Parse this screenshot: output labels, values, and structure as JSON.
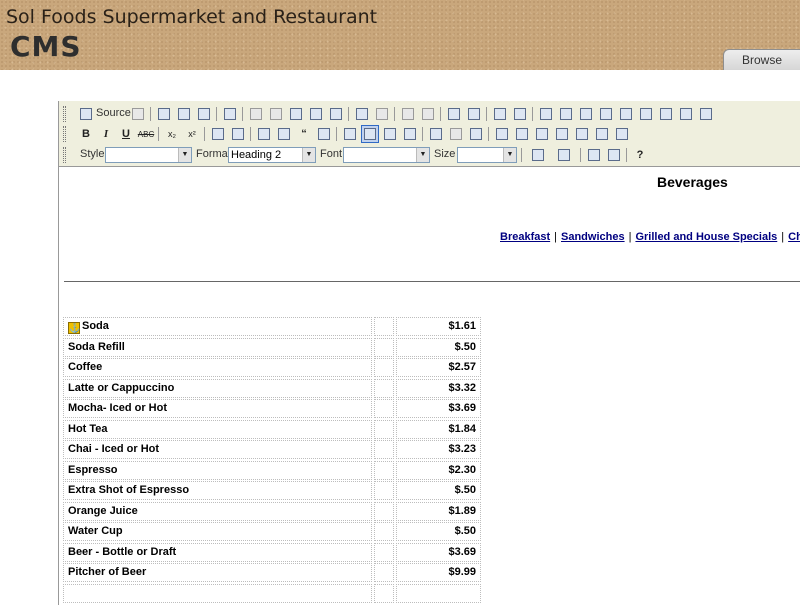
{
  "header": {
    "site_title": "Sol Foods Supermarket and Restaurant",
    "logo_text": "CMS",
    "browse_tab": "Browse"
  },
  "toolbar": {
    "source_label": "Source",
    "style_label": "Style",
    "style_value": "",
    "format_label": "Format",
    "format_value": "Heading 2",
    "font_label": "Font",
    "font_value": "",
    "size_label": "Size",
    "size_value": ""
  },
  "content": {
    "heading": "Beverages",
    "nav_links": [
      "Breakfast",
      "Sandwiches",
      "Grilled and House Specials",
      "Child"
    ],
    "pipe": "|",
    "menu_items": [
      {
        "name": "Soda",
        "price": "$1.61"
      },
      {
        "name": "Soda Refill",
        "price": "$.50"
      },
      {
        "name": "Coffee",
        "price": "$2.57"
      },
      {
        "name": "Latte or Cappuccino",
        "price": "$3.32"
      },
      {
        "name": "Mocha- Iced or Hot",
        "price": "$3.69"
      },
      {
        "name": "Hot Tea",
        "price": "$1.84"
      },
      {
        "name": "Chai - Iced or Hot",
        "price": "$3.23"
      },
      {
        "name": "Espresso",
        "price": "$2.30"
      },
      {
        "name": "Extra Shot of Espresso",
        "price": "$.50"
      },
      {
        "name": "Orange Juice",
        "price": "$1.89"
      },
      {
        "name": "Water Cup",
        "price": "$.50"
      },
      {
        "name": "Beer - Bottle or Draft",
        "price": "$3.69"
      },
      {
        "name": "Pitcher of Beer",
        "price": "$9.99"
      },
      {
        "name": "",
        "price": ""
      }
    ]
  }
}
